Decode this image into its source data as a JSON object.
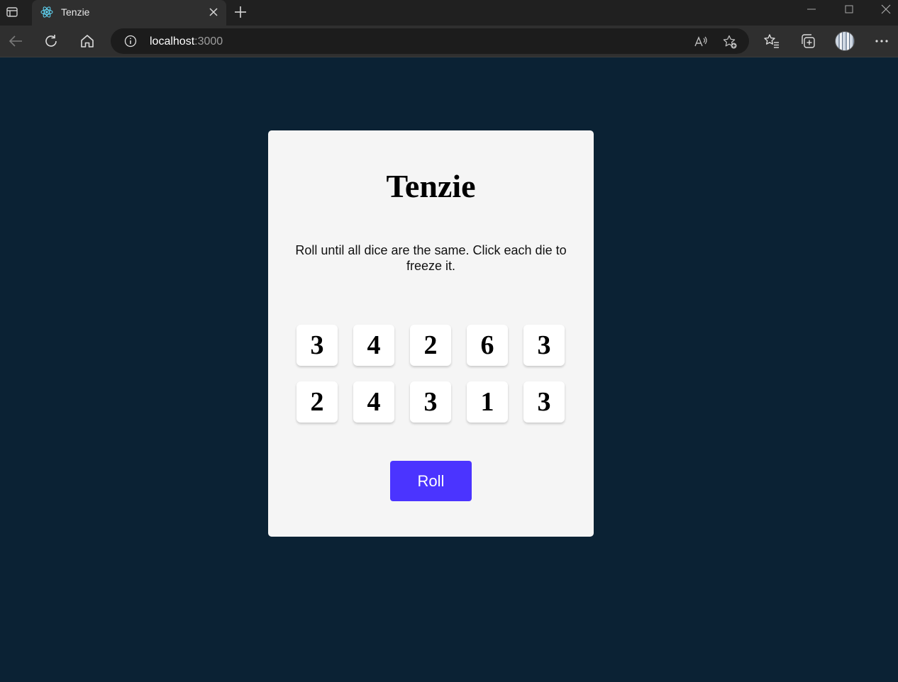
{
  "browser": {
    "tab_title": "Tenzie",
    "url_host": "localhost",
    "url_port": ":3000"
  },
  "game": {
    "title": "Tenzie",
    "instructions": "Roll until all dice are the same. Click each die to freeze it.",
    "dice": [
      "3",
      "4",
      "2",
      "6",
      "3",
      "2",
      "4",
      "3",
      "1",
      "3"
    ],
    "roll_label": "Roll"
  },
  "colors": {
    "page_background": "#0b2234",
    "card_background": "#f5f5f5",
    "roll_button": "#4b34ff"
  }
}
